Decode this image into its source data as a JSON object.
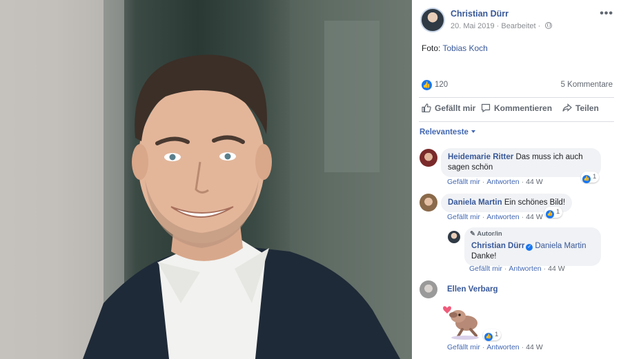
{
  "post": {
    "author": "Christian Dürr",
    "date": "20. Mai 2019",
    "meta_separator": "·",
    "edited": "Bearbeitet",
    "visibility_icon": "globe-icon",
    "more_icon": "•••",
    "caption_prefix": "Foto: ",
    "caption_link": "Tobias Koch"
  },
  "stats": {
    "like_icon": "👍",
    "likes": "120",
    "comments": "5 Kommentare"
  },
  "actions": {
    "like": "Gefällt mir",
    "comment": "Kommentieren",
    "share": "Teilen"
  },
  "sort": {
    "label": "Relevanteste"
  },
  "comments": [
    {
      "author": "Heidemarie Ritter",
      "text_line1": "Das muss ich auch",
      "text_line2": "sagen schön",
      "like": "Gefällt mir",
      "reply": "Antworten",
      "age": "44 W",
      "reactions": "1"
    },
    {
      "author": "Daniela Martin",
      "text": "Ein schönes Bild!",
      "like": "Gefällt mir",
      "reply": "Antworten",
      "age": "44 W",
      "reactions": "1"
    },
    {
      "tag": "Autor/in",
      "author": "Christian Dürr",
      "mention": "Daniela Martin",
      "text": "Danke!",
      "like": "Gefällt mir",
      "reply": "Antworten",
      "age": "44 W"
    },
    {
      "author": "Ellen Verbarg",
      "sticker": "dancing-dog-sticker",
      "like": "Gefällt mir",
      "reply": "Antworten",
      "age": "44 W",
      "reactions": "1"
    }
  ],
  "colors": {
    "link": "#385898",
    "accent": "#1877f2",
    "bubble": "#f0f2f5"
  }
}
